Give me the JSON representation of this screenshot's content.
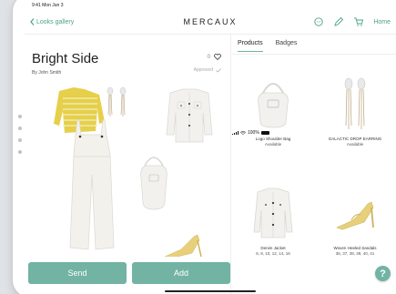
{
  "status_bar": {
    "time": "9:41",
    "date": "Mon Jun 3",
    "battery": "100%"
  },
  "nav": {
    "back_label": "Looks gallery",
    "brand": "MERCAUX",
    "home_label": "Home",
    "icons": [
      "chat-icon",
      "edit-icon",
      "cart-icon"
    ]
  },
  "look": {
    "title": "Bright Side",
    "author": "By John Smith",
    "likes": "0",
    "status": "Approved",
    "send_label": "Send",
    "add_label": "Add"
  },
  "tabs": [
    {
      "label": "Products",
      "active": true
    },
    {
      "label": "Badges",
      "active": false
    }
  ],
  "products": [
    {
      "name": "Logo Shoulder Bag",
      "sub": "Available",
      "icon": "bag"
    },
    {
      "name": "GALACTIC DROP EARRING",
      "sub": "Available",
      "icon": "earring"
    },
    {
      "name": "Denim Jacket",
      "sub": "6, 8, 10, 12, 14, 16",
      "icon": "jacket"
    },
    {
      "name": "Woven Heeled Sandals",
      "sub": "36, 37, 38, 39, 40, 41",
      "icon": "sandal"
    }
  ],
  "help_label": "?",
  "colors": {
    "accent": "#72b3a3",
    "link": "#4aa28a",
    "sweater": "#e6cf4a"
  }
}
